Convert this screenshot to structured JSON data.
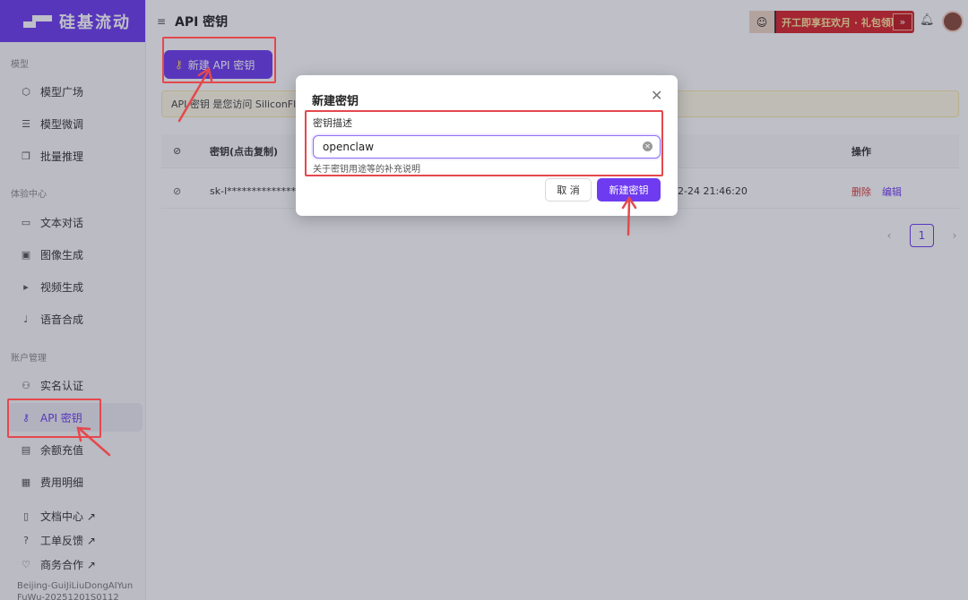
{
  "sidebar": {
    "brand": "硅基流动",
    "sections": {
      "models": "模型",
      "experience": "体验中心",
      "account": "账户管理"
    },
    "items": [
      {
        "label": "模型广场",
        "icon": "cube-icon"
      },
      {
        "label": "模型微调",
        "icon": "sliders-icon"
      },
      {
        "label": "批量推理",
        "icon": "copy-icon"
      },
      {
        "label": "文本对话",
        "icon": "chat-icon"
      },
      {
        "label": "图像生成",
        "icon": "image-icon"
      },
      {
        "label": "视频生成",
        "icon": "video-icon"
      },
      {
        "label": "语音合成",
        "icon": "mic-icon"
      },
      {
        "label": "实名认证",
        "icon": "user-check-icon"
      },
      {
        "label": "API 密钥",
        "icon": "key-icon"
      },
      {
        "label": "余额充值",
        "icon": "card-icon"
      },
      {
        "label": "费用明细",
        "icon": "document-icon"
      },
      {
        "label": "文档中心 ↗",
        "icon": "book-icon"
      },
      {
        "label": "工单反馈 ↗",
        "icon": "question-icon"
      },
      {
        "label": "商务合作 ↗",
        "icon": "handshake-icon"
      }
    ],
    "active_item": "API 密钥",
    "footer_line1": "Beijing-GuiJiLiuDongAIYun",
    "footer_line2": "FuWu-20251201S0112"
  },
  "header": {
    "title": "API 密钥",
    "promo_text": "开工即享狂欢月 · 礼包领取",
    "promo_arrow": "»"
  },
  "main": {
    "new_key_button": "新建 API 密钥",
    "banner_text": "API 密钥 是您访问 SiliconFl",
    "table": {
      "col_key": "密钥(点击复制)",
      "col_actions": "操作",
      "row": {
        "key": "sk-l***************",
        "created": "2-24 21:46:20",
        "delete": "删除",
        "edit": "编辑"
      }
    },
    "pagination": {
      "prev": "‹",
      "page": "1",
      "next": "›"
    }
  },
  "modal": {
    "title": "新建密钥",
    "field_label": "密钥描述",
    "input_value": "openclaw",
    "help_text": "关于密钥用途等的补充说明",
    "cancel": "取 消",
    "confirm": "新建密钥"
  },
  "colors": {
    "accent": "#6e3bf0",
    "annotation": "#e5484d",
    "danger": "#d83b3b"
  }
}
